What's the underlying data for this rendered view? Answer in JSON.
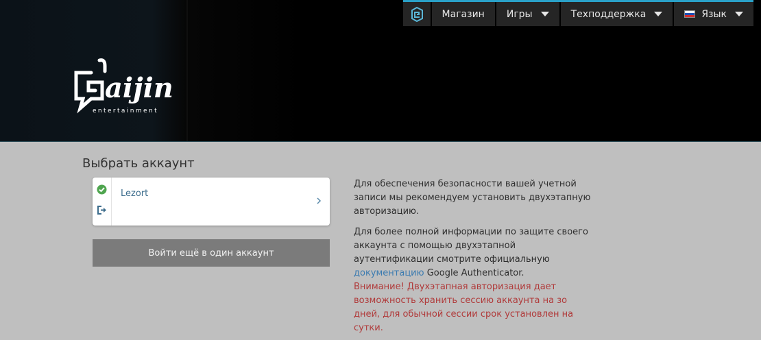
{
  "nav": {
    "items": [
      {
        "label": "Магазин",
        "dropdown": false
      },
      {
        "label": "Игры",
        "dropdown": true
      },
      {
        "label": "Техподдержка",
        "dropdown": true
      },
      {
        "label": "Язык",
        "dropdown": true
      }
    ],
    "accent_color": "#2aa1c8"
  },
  "logo": {
    "word": "aijin",
    "sub": "entertainment"
  },
  "page": {
    "title": "Выбрать аккаунт"
  },
  "account": {
    "name": "Lezort",
    "status_icon": "check-circle-icon",
    "logout_icon": "logout-icon"
  },
  "add_account_button": "Войти ещё в один аккаунт",
  "info": {
    "p1": "Для обеспечения безопасности вашей учетной записи мы рекомендуем установить двухэтапную авторизацию.",
    "p2_before": "Для более полной информации по защите своего аккаунта с помощью двухэтапной аутентификации смотрите официальную ",
    "p2_link": "документацию",
    "p2_after": " Google Authenticator.",
    "warning": "Внимание! Двухэтапная авторизация дает возможность хранить сессию аккаунта на зо дней, для обычной сессии срок установлен на сутки."
  }
}
